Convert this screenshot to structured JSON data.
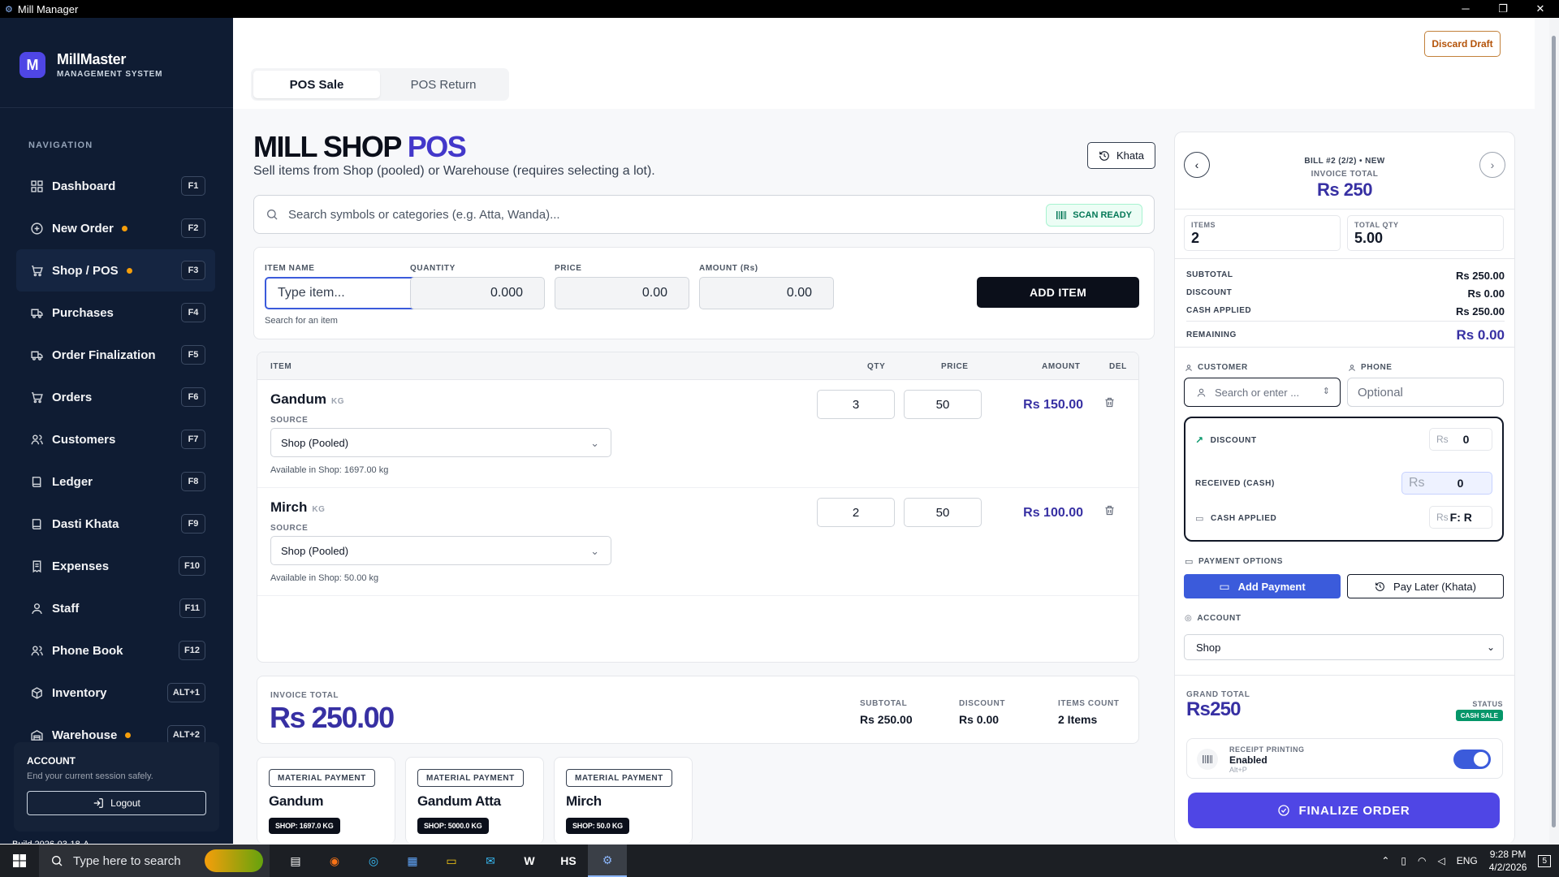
{
  "window": {
    "title": "Mill Manager",
    "controls": [
      "─",
      "❐",
      "✕"
    ]
  },
  "brand": {
    "logo_letter": "M",
    "name": "MillMaster",
    "subtitle": "MANAGEMENT SYSTEM"
  },
  "sidebar": {
    "nav_label": "NAVIGATION",
    "items": [
      {
        "label": "Dashboard",
        "key": "F1",
        "icon": "grid-icon",
        "dot": false,
        "active": false
      },
      {
        "label": "New Order",
        "key": "F2",
        "icon": "plus-circle-icon",
        "dot": true,
        "active": false
      },
      {
        "label": "Shop / POS",
        "key": "F3",
        "icon": "cart-icon",
        "dot": true,
        "active": true
      },
      {
        "label": "Purchases",
        "key": "F4",
        "icon": "truck-icon",
        "dot": false,
        "active": false
      },
      {
        "label": "Order Finalization",
        "key": "F5",
        "icon": "truck-icon",
        "dot": false,
        "active": false
      },
      {
        "label": "Orders",
        "key": "F6",
        "icon": "cart-icon",
        "dot": false,
        "active": false
      },
      {
        "label": "Customers",
        "key": "F7",
        "icon": "users-icon",
        "dot": false,
        "active": false
      },
      {
        "label": "Ledger",
        "key": "F8",
        "icon": "book-icon",
        "dot": false,
        "active": false
      },
      {
        "label": "Dasti Khata",
        "key": "F9",
        "icon": "book-icon",
        "dot": false,
        "active": false
      },
      {
        "label": "Expenses",
        "key": "F10",
        "icon": "receipt-icon",
        "dot": false,
        "active": false
      },
      {
        "label": "Staff",
        "key": "F11",
        "icon": "user-icon",
        "dot": false,
        "active": false
      },
      {
        "label": "Phone Book",
        "key": "F12",
        "icon": "users-icon",
        "dot": false,
        "active": false
      },
      {
        "label": "Inventory",
        "key": "ALT+1",
        "icon": "box-icon",
        "dot": false,
        "active": false
      },
      {
        "label": "Warehouse",
        "key": "ALT+2",
        "icon": "warehouse-icon",
        "dot": true,
        "active": false
      }
    ],
    "account": {
      "title": "ACCOUNT",
      "subtitle": "End your current session safely.",
      "logout_label": "Logout"
    },
    "build": "Build 2026-03-18-A"
  },
  "header": {
    "discard_label": "Discard Draft",
    "tabs": [
      "POS Sale",
      "POS Return"
    ]
  },
  "pos": {
    "title_main": "MILL SHOP",
    "title_accent": "POS",
    "subtitle": "Sell items from Shop (pooled) or Warehouse (requires selecting a lot).",
    "khata_label": "Khata",
    "search_placeholder": "Search symbols or categories (e.g. Atta, Wanda)...",
    "scan_label": "SCAN READY",
    "entry": {
      "item_label": "ITEM NAME",
      "item_placeholder": "Type item...",
      "qty_label": "QUANTITY",
      "qty_value": "0.000",
      "price_label": "PRICE",
      "price_value": "0.00",
      "amount_label": "AMOUNT (Rs)",
      "amount_value": "0.00",
      "hint": "Search for an item",
      "add_label": "ADD ITEM"
    },
    "table_headers": {
      "item": "ITEM",
      "qty": "QTY",
      "price": "PRICE",
      "amount": "AMOUNT",
      "del": "DEL"
    },
    "source_label": "SOURCE",
    "lines": [
      {
        "name": "Gandum",
        "unit": "KG",
        "source": "Shop (Pooled)",
        "available": "Available in Shop: 1697.00 kg",
        "qty": "3",
        "price": "50",
        "amount": "Rs 150.00"
      },
      {
        "name": "Mirch",
        "unit": "KG",
        "source": "Shop (Pooled)",
        "available": "Available in Shop: 50.00 kg",
        "qty": "2",
        "price": "50",
        "amount": "Rs 100.00"
      }
    ],
    "totals": {
      "invoice_label": "INVOICE TOTAL",
      "invoice_value": "Rs 250.00",
      "subtotal_label": "SUBTOTAL",
      "subtotal_value": "Rs 250.00",
      "discount_label": "DISCOUNT",
      "discount_value": "Rs 0.00",
      "count_label": "ITEMS COUNT",
      "count_value": "2 Items"
    },
    "materials": [
      {
        "badge": "MATERIAL PAYMENT",
        "name": "Gandum",
        "stock": "SHOP: 1697.0 KG"
      },
      {
        "badge": "MATERIAL PAYMENT",
        "name": "Gandum Atta",
        "stock": "SHOP: 5000.0 KG"
      },
      {
        "badge": "MATERIAL PAYMENT",
        "name": "Mirch",
        "stock": "SHOP: 50.0 KG"
      }
    ]
  },
  "bill": {
    "bill_label": "BILL #2 (2/2) • NEW",
    "invoice_label": "INVOICE TOTAL",
    "invoice_value": "Rs 250",
    "items_label": "ITEMS",
    "items_value": "2",
    "qty_label": "TOTAL QTY",
    "qty_value": "5.00",
    "summary": [
      {
        "label": "SUBTOTAL",
        "value": "Rs 250.00"
      },
      {
        "label": "DISCOUNT",
        "value": "Rs 0.00"
      },
      {
        "label": "CASH APPLIED",
        "value": "Rs 250.00"
      }
    ],
    "remaining_label": "REMAINING",
    "remaining_value": "Rs 0.00",
    "customer_label": "CUSTOMER",
    "customer_placeholder": "Search or enter ...",
    "phone_label": "PHONE",
    "phone_placeholder": "Optional",
    "discount_label": "DISCOUNT",
    "discount_currency": "Rs",
    "discount_value": "0",
    "received_label": "RECEIVED (CASH)",
    "received_currency": "Rs",
    "received_value": "0",
    "cash_label": "CASH APPLIED",
    "cash_currency": "Rs",
    "cash_value": "F: R",
    "payment_label": "PAYMENT OPTIONS",
    "add_payment_label": "Add Payment",
    "pay_later_label": "Pay Later (Khata)",
    "account_label": "ACCOUNT",
    "account_value": "Shop",
    "grand_label": "GRAND TOTAL",
    "grand_value": "Rs250",
    "status_label": "STATUS",
    "status_value": "CASH SALE",
    "receipt_label": "RECEIPT PRINTING",
    "receipt_value": "Enabled",
    "receipt_key": "Alt+P",
    "receipt_on": true,
    "finalize_label": "FINALIZE ORDER"
  },
  "taskbar": {
    "search_placeholder": "Type here to search",
    "apps": [
      "▤",
      "◉",
      "◎",
      "▦",
      "▭",
      "✉",
      "W",
      "HS",
      "⚙"
    ],
    "lang": "ENG",
    "time": "9:28 PM",
    "date": "4/2/2026",
    "notif": "5"
  },
  "colors": {
    "sidebar_bg": "#0f1c33",
    "accent": "#3730a3",
    "primary_button": "#4f46e5",
    "warning_dot": "#f59e0b",
    "success": "#059669"
  }
}
